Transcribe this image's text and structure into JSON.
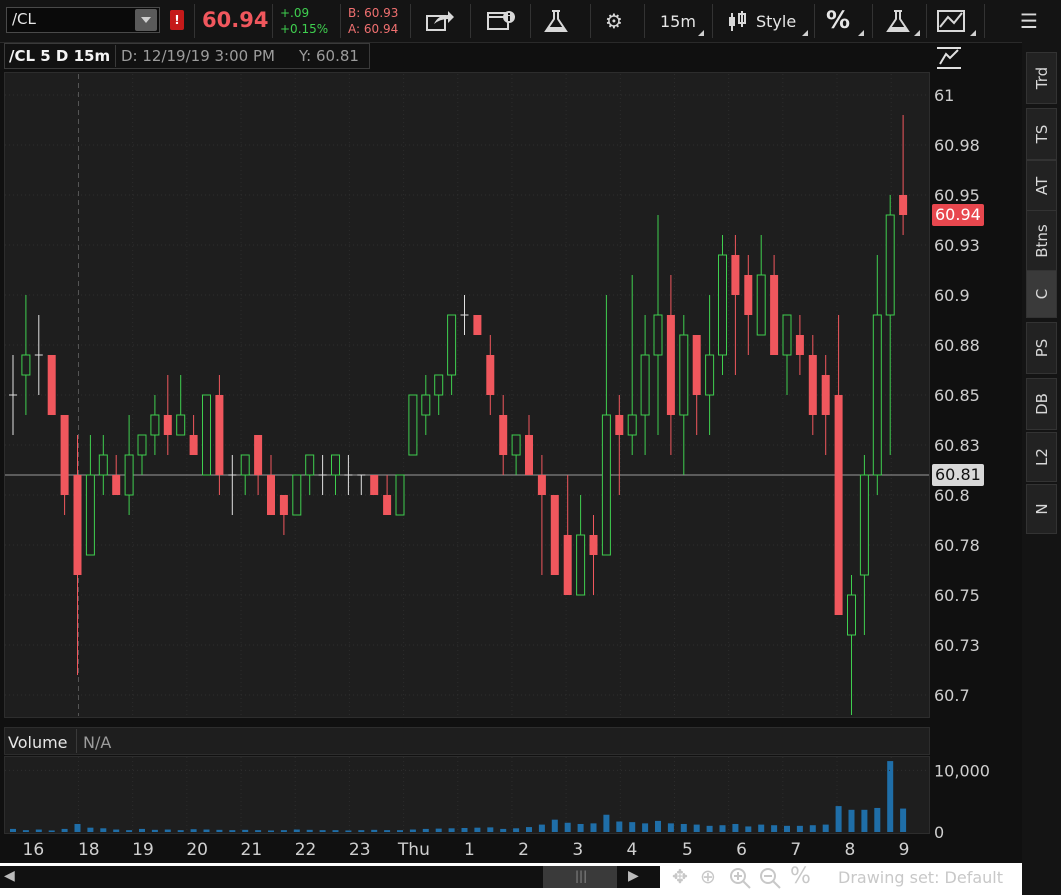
{
  "toolbar": {
    "symbol": "/CL",
    "alert_badge": "!",
    "last_price": "60.94",
    "net_change": "+.09",
    "net_change_pct": "+0.15%",
    "bid": "B: 60.93",
    "ask": "A: 60.94",
    "interval": "15m",
    "style_label": "Style",
    "percent_label": "%",
    "menu_icon": "hamburger-icon",
    "colors": {
      "up": "#3fcf4f",
      "down": "#f0575d",
      "bg": "#141414"
    }
  },
  "chart_header": {
    "title": "/CL 5 D 15m",
    "date": "D: 12/19/19 3:00 PM",
    "y": "Y: 60.81"
  },
  "volume_header": {
    "label": "Volume",
    "value": "N/A"
  },
  "side_tabs": [
    "Trd",
    "TS",
    "AT",
    "Btns",
    "C",
    "PS",
    "DB",
    "L2",
    "N"
  ],
  "side_tab_active": "C",
  "bottom": {
    "drawing_set": "Drawing set: Default",
    "percent": "%"
  },
  "chart_data": {
    "type": "candlestick",
    "symbol": "/CL",
    "price_axis": {
      "ticks": [
        "61",
        "60.98",
        "60.95",
        "60.93",
        "60.9",
        "60.88",
        "60.85",
        "60.83",
        "60.8",
        "60.78",
        "60.75",
        "60.73",
        "60.7"
      ],
      "ylim": [
        60.69,
        61.01
      ]
    },
    "current_price_label": "60.94",
    "crosshair_label": "60.81",
    "crosshair_price": 60.81,
    "volume_axis": {
      "ticks": [
        "10,000",
        "0"
      ],
      "ylim": [
        0,
        12000
      ]
    },
    "x_labels": [
      "16",
      "18",
      "19",
      "20",
      "21",
      "22",
      "23",
      "Thu",
      "1",
      "2",
      "3",
      "4",
      "5",
      "6",
      "7",
      "8",
      "9"
    ],
    "candles": [
      {
        "o": 60.85,
        "h": 60.87,
        "l": 60.83,
        "c": 60.85
      },
      {
        "o": 60.86,
        "h": 60.9,
        "l": 60.84,
        "c": 60.87
      },
      {
        "o": 60.87,
        "h": 60.89,
        "l": 60.85,
        "c": 60.87
      },
      {
        "o": 60.87,
        "h": 60.87,
        "l": 60.84,
        "c": 60.84
      },
      {
        "o": 60.84,
        "h": 60.84,
        "l": 60.79,
        "c": 60.8
      },
      {
        "o": 60.81,
        "h": 60.83,
        "l": 60.71,
        "c": 60.76
      },
      {
        "o": 60.77,
        "h": 60.83,
        "l": 60.77,
        "c": 60.81
      },
      {
        "o": 60.81,
        "h": 60.83,
        "l": 60.8,
        "c": 60.82
      },
      {
        "o": 60.81,
        "h": 60.82,
        "l": 60.8,
        "c": 60.8
      },
      {
        "o": 60.8,
        "h": 60.84,
        "l": 60.79,
        "c": 60.82
      },
      {
        "o": 60.82,
        "h": 60.83,
        "l": 60.81,
        "c": 60.83
      },
      {
        "o": 60.83,
        "h": 60.85,
        "l": 60.82,
        "c": 60.84
      },
      {
        "o": 60.84,
        "h": 60.86,
        "l": 60.82,
        "c": 60.83
      },
      {
        "o": 60.83,
        "h": 60.86,
        "l": 60.83,
        "c": 60.84
      },
      {
        "o": 60.83,
        "h": 60.84,
        "l": 60.82,
        "c": 60.82
      },
      {
        "o": 60.81,
        "h": 60.85,
        "l": 60.81,
        "c": 60.85
      },
      {
        "o": 60.85,
        "h": 60.86,
        "l": 60.8,
        "c": 60.81
      },
      {
        "o": 60.81,
        "h": 60.82,
        "l": 60.79,
        "c": 60.81
      },
      {
        "o": 60.81,
        "h": 60.82,
        "l": 60.8,
        "c": 60.82
      },
      {
        "o": 60.83,
        "h": 60.83,
        "l": 60.8,
        "c": 60.81
      },
      {
        "o": 60.81,
        "h": 60.82,
        "l": 60.79,
        "c": 60.79
      },
      {
        "o": 60.8,
        "h": 60.8,
        "l": 60.78,
        "c": 60.79
      },
      {
        "o": 60.79,
        "h": 60.81,
        "l": 60.79,
        "c": 60.81
      },
      {
        "o": 60.81,
        "h": 60.82,
        "l": 60.8,
        "c": 60.82
      },
      {
        "o": 60.81,
        "h": 60.82,
        "l": 60.8,
        "c": 60.81
      },
      {
        "o": 60.81,
        "h": 60.82,
        "l": 60.8,
        "c": 60.82
      },
      {
        "o": 60.81,
        "h": 60.82,
        "l": 60.8,
        "c": 60.81
      },
      {
        "o": 60.81,
        "h": 60.81,
        "l": 60.8,
        "c": 60.81
      },
      {
        "o": 60.81,
        "h": 60.81,
        "l": 60.8,
        "c": 60.8
      },
      {
        "o": 60.8,
        "h": 60.81,
        "l": 60.79,
        "c": 60.79
      },
      {
        "o": 60.79,
        "h": 60.81,
        "l": 60.79,
        "c": 60.81
      },
      {
        "o": 60.82,
        "h": 60.85,
        "l": 60.82,
        "c": 60.85
      },
      {
        "o": 60.84,
        "h": 60.86,
        "l": 60.83,
        "c": 60.85
      },
      {
        "o": 60.85,
        "h": 60.86,
        "l": 60.84,
        "c": 60.86
      },
      {
        "o": 60.86,
        "h": 60.89,
        "l": 60.85,
        "c": 60.89
      },
      {
        "o": 60.89,
        "h": 60.9,
        "l": 60.88,
        "c": 60.89
      },
      {
        "o": 60.89,
        "h": 60.89,
        "l": 60.88,
        "c": 60.88
      },
      {
        "o": 60.87,
        "h": 60.88,
        "l": 60.84,
        "c": 60.85
      },
      {
        "o": 60.84,
        "h": 60.85,
        "l": 60.81,
        "c": 60.82
      },
      {
        "o": 60.82,
        "h": 60.83,
        "l": 60.81,
        "c": 60.83
      },
      {
        "o": 60.83,
        "h": 60.84,
        "l": 60.81,
        "c": 60.81
      },
      {
        "o": 60.81,
        "h": 60.82,
        "l": 60.76,
        "c": 60.8
      },
      {
        "o": 60.8,
        "h": 60.8,
        "l": 60.76,
        "c": 60.76
      },
      {
        "o": 60.78,
        "h": 60.81,
        "l": 60.75,
        "c": 60.75
      },
      {
        "o": 60.75,
        "h": 60.8,
        "l": 60.75,
        "c": 60.78
      },
      {
        "o": 60.78,
        "h": 60.79,
        "l": 60.75,
        "c": 60.77
      },
      {
        "o": 60.77,
        "h": 60.9,
        "l": 60.77,
        "c": 60.84
      },
      {
        "o": 60.84,
        "h": 60.85,
        "l": 60.8,
        "c": 60.83
      },
      {
        "o": 60.83,
        "h": 60.91,
        "l": 60.82,
        "c": 60.84
      },
      {
        "o": 60.84,
        "h": 60.89,
        "l": 60.82,
        "c": 60.87
      },
      {
        "o": 60.87,
        "h": 60.94,
        "l": 60.83,
        "c": 60.89
      },
      {
        "o": 60.89,
        "h": 60.91,
        "l": 60.82,
        "c": 60.84
      },
      {
        "o": 60.84,
        "h": 60.89,
        "l": 60.81,
        "c": 60.88
      },
      {
        "o": 60.88,
        "h": 60.88,
        "l": 60.83,
        "c": 60.85
      },
      {
        "o": 60.85,
        "h": 60.9,
        "l": 60.83,
        "c": 60.87
      },
      {
        "o": 60.87,
        "h": 60.93,
        "l": 60.86,
        "c": 60.92
      },
      {
        "o": 60.92,
        "h": 60.93,
        "l": 60.86,
        "c": 60.9
      },
      {
        "o": 60.91,
        "h": 60.92,
        "l": 60.87,
        "c": 60.89
      },
      {
        "o": 60.88,
        "h": 60.93,
        "l": 60.88,
        "c": 60.91
      },
      {
        "o": 60.91,
        "h": 60.92,
        "l": 60.87,
        "c": 60.87
      },
      {
        "o": 60.87,
        "h": 60.88,
        "l": 60.85,
        "c": 60.89
      },
      {
        "o": 60.88,
        "h": 60.89,
        "l": 60.86,
        "c": 60.87
      },
      {
        "o": 60.87,
        "h": 60.88,
        "l": 60.83,
        "c": 60.84
      },
      {
        "o": 60.86,
        "h": 60.87,
        "l": 60.82,
        "c": 60.84
      },
      {
        "o": 60.85,
        "h": 60.89,
        "l": 60.74,
        "c": 60.74
      },
      {
        "o": 60.73,
        "h": 60.76,
        "l": 60.69,
        "c": 60.75
      },
      {
        "o": 60.76,
        "h": 60.82,
        "l": 60.73,
        "c": 60.81
      },
      {
        "o": 60.81,
        "h": 60.92,
        "l": 60.8,
        "c": 60.89
      },
      {
        "o": 60.89,
        "h": 60.95,
        "l": 60.82,
        "c": 60.94
      },
      {
        "o": 60.95,
        "h": 60.99,
        "l": 60.93,
        "c": 60.94
      }
    ],
    "volume": [
      500,
      300,
      400,
      250,
      500,
      1300,
      700,
      600,
      400,
      300,
      500,
      350,
      400,
      300,
      450,
      400,
      350,
      300,
      350,
      300,
      250,
      300,
      400,
      350,
      300,
      300,
      250,
      300,
      350,
      300,
      300,
      400,
      500,
      550,
      600,
      650,
      700,
      750,
      500,
      600,
      800,
      1200,
      2000,
      1500,
      1300,
      1400,
      2800,
      1700,
      1600,
      1400,
      1800,
      1400,
      1300,
      1200,
      1000,
      1100,
      1300,
      900,
      1200,
      1100,
      1000,
      1000,
      1100,
      1200,
      4200,
      3600,
      3600,
      3900,
      11500,
      3800
    ]
  }
}
